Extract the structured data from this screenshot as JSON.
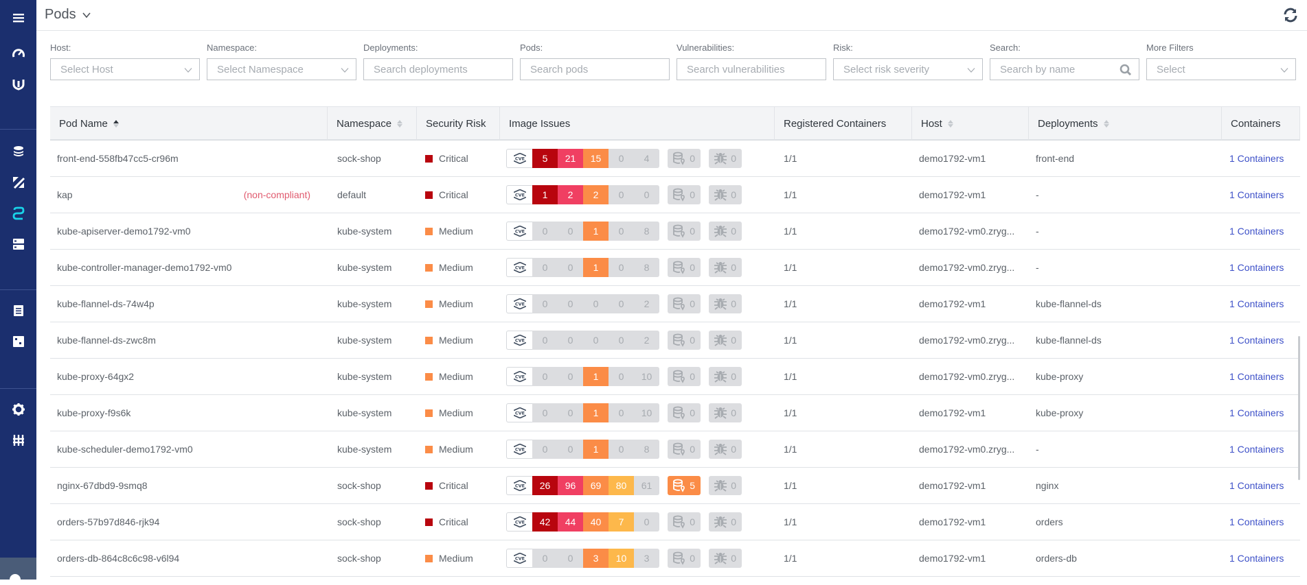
{
  "colors": {
    "sidebar_bg": "#1b2f6e",
    "active_icon": "#19d3e8",
    "critical": "#b8050e",
    "high": "#f03f62",
    "medium": "#fb8c47",
    "low": "#fdb84b",
    "none": "#dcdde0",
    "link": "#3d50c8",
    "non_compliant": "#e05a6e"
  },
  "sidebar": {
    "items": [
      {
        "icon": "menu-icon"
      },
      {
        "icon": "dashboard-gauge-icon"
      },
      {
        "icon": "topology-icon"
      },
      {
        "icon": "layers-icon"
      },
      {
        "icon": "compliance-icon"
      },
      {
        "icon": "integrations-icon",
        "active": true
      },
      {
        "icon": "registry-icon"
      },
      {
        "icon": "reports-icon"
      },
      {
        "icon": "notifications-icon"
      },
      {
        "icon": "settings-icon"
      },
      {
        "icon": "filters-icon"
      }
    ]
  },
  "header": {
    "title": "Pods",
    "refresh_icon": "refresh-icon"
  },
  "filters": [
    {
      "label": "Host:",
      "type": "select",
      "placeholder": "Select Host"
    },
    {
      "label": "Namespace:",
      "type": "select",
      "placeholder": "Select Namespace"
    },
    {
      "label": "Deployments:",
      "type": "input",
      "placeholder": "Search deployments"
    },
    {
      "label": "Pods:",
      "type": "input",
      "placeholder": "Search pods"
    },
    {
      "label": "Vulnerabilities:",
      "type": "input",
      "placeholder": "Search vulnerabilities"
    },
    {
      "label": "Risk:",
      "type": "select",
      "placeholder": "Select risk severity"
    },
    {
      "label": "Search:",
      "type": "search",
      "placeholder": "Search by name"
    },
    {
      "label": "More Filters",
      "type": "select",
      "placeholder": "Select"
    }
  ],
  "table": {
    "columns": [
      {
        "label": "Pod Name",
        "sortable": true,
        "sort": "asc"
      },
      {
        "label": "Namespace",
        "sortable": true
      },
      {
        "label": "Security Risk",
        "sortable": false
      },
      {
        "label": "Image Issues",
        "sortable": false
      },
      {
        "label": "Registered Containers",
        "sortable": false
      },
      {
        "label": "Host",
        "sortable": true
      },
      {
        "label": "Deployments",
        "sortable": true
      },
      {
        "label": "Containers",
        "sortable": false
      }
    ],
    "rows": [
      {
        "name": "front-end-558fb47cc5-cr96m",
        "tag": "",
        "namespace": "sock-shop",
        "risk": "Critical",
        "cves": [
          5,
          21,
          15,
          0,
          4
        ],
        "secrets": 0,
        "malware": 0,
        "registered": "1/1",
        "host": "demo1792-vm1",
        "deployment": "front-end",
        "containers": "1 Containers"
      },
      {
        "name": "kap",
        "tag": "(non-compliant)",
        "namespace": "default",
        "risk": "Critical",
        "cves": [
          1,
          2,
          2,
          0,
          0
        ],
        "secrets": 0,
        "malware": 0,
        "registered": "1/1",
        "host": "demo1792-vm1",
        "deployment": "-",
        "containers": "1 Containers"
      },
      {
        "name": "kube-apiserver-demo1792-vm0",
        "tag": "",
        "namespace": "kube-system",
        "risk": "Medium",
        "cves": [
          0,
          0,
          1,
          0,
          8
        ],
        "secrets": 0,
        "malware": 0,
        "registered": "1/1",
        "host": "demo1792-vm0.zryg...",
        "deployment": "-",
        "containers": "1 Containers"
      },
      {
        "name": "kube-controller-manager-demo1792-vm0",
        "tag": "",
        "namespace": "kube-system",
        "risk": "Medium",
        "cves": [
          0,
          0,
          1,
          0,
          8
        ],
        "secrets": 0,
        "malware": 0,
        "registered": "1/1",
        "host": "demo1792-vm0.zryg...",
        "deployment": "-",
        "containers": "1 Containers"
      },
      {
        "name": "kube-flannel-ds-74w4p",
        "tag": "",
        "namespace": "kube-system",
        "risk": "Medium",
        "cves": [
          0,
          0,
          0,
          0,
          2
        ],
        "secrets": 0,
        "malware": 0,
        "registered": "1/1",
        "host": "demo1792-vm1",
        "deployment": "kube-flannel-ds",
        "containers": "1 Containers"
      },
      {
        "name": "kube-flannel-ds-zwc8m",
        "tag": "",
        "namespace": "kube-system",
        "risk": "Medium",
        "cves": [
          0,
          0,
          0,
          0,
          2
        ],
        "secrets": 0,
        "malware": 0,
        "registered": "1/1",
        "host": "demo1792-vm0.zryg...",
        "deployment": "kube-flannel-ds",
        "containers": "1 Containers"
      },
      {
        "name": "kube-proxy-64gx2",
        "tag": "",
        "namespace": "kube-system",
        "risk": "Medium",
        "cves": [
          0,
          0,
          1,
          0,
          10
        ],
        "secrets": 0,
        "malware": 0,
        "registered": "1/1",
        "host": "demo1792-vm0.zryg...",
        "deployment": "kube-proxy",
        "containers": "1 Containers"
      },
      {
        "name": "kube-proxy-f9s6k",
        "tag": "",
        "namespace": "kube-system",
        "risk": "Medium",
        "cves": [
          0,
          0,
          1,
          0,
          10
        ],
        "secrets": 0,
        "malware": 0,
        "registered": "1/1",
        "host": "demo1792-vm1",
        "deployment": "kube-proxy",
        "containers": "1 Containers"
      },
      {
        "name": "kube-scheduler-demo1792-vm0",
        "tag": "",
        "namespace": "kube-system",
        "risk": "Medium",
        "cves": [
          0,
          0,
          1,
          0,
          8
        ],
        "secrets": 0,
        "malware": 0,
        "registered": "1/1",
        "host": "demo1792-vm0.zryg...",
        "deployment": "-",
        "containers": "1 Containers"
      },
      {
        "name": "nginx-67dbd9-9smq8",
        "tag": "",
        "namespace": "sock-shop",
        "risk": "Critical",
        "cves": [
          26,
          96,
          69,
          80,
          61
        ],
        "secrets": 5,
        "malware": 0,
        "registered": "1/1",
        "host": "demo1792-vm1",
        "deployment": "nginx",
        "containers": "1 Containers"
      },
      {
        "name": "orders-57b97d846-rjk94",
        "tag": "",
        "namespace": "sock-shop",
        "risk": "Critical",
        "cves": [
          42,
          44,
          40,
          7,
          0
        ],
        "secrets": 0,
        "malware": 0,
        "registered": "1/1",
        "host": "demo1792-vm1",
        "deployment": "orders",
        "containers": "1 Containers"
      },
      {
        "name": "orders-db-864c8c6c98-v6l94",
        "tag": "",
        "namespace": "sock-shop",
        "risk": "Medium",
        "cves": [
          0,
          0,
          3,
          10,
          3
        ],
        "secrets": 0,
        "malware": 0,
        "registered": "1/1",
        "host": "demo1792-vm1",
        "deployment": "orders-db",
        "containers": "1 Containers"
      }
    ]
  }
}
